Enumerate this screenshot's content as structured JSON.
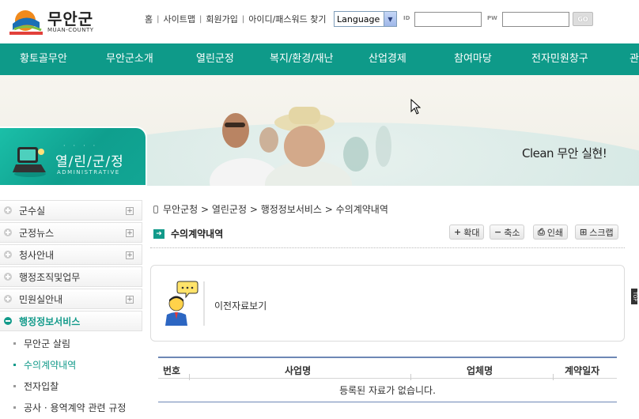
{
  "header": {
    "logo_name": "무안군",
    "logo_sub": "MUAN-COUNTY",
    "util_links": [
      "홈",
      "사이트맵",
      "회원가입",
      "아이디/패스워드 찾기"
    ],
    "language_value": "Language",
    "id_label": "ID",
    "pw_label": "PW",
    "go_label": "GO"
  },
  "nav": {
    "items": [
      "황토골무안",
      "무안군소개",
      "열린군정",
      "복지/환경/재난",
      "산업경제",
      "참여마당",
      "전자민원창구",
      "관"
    ]
  },
  "banner": {
    "slogan": "Clean 무안 실현!"
  },
  "side_title": {
    "ko": "열/린/군/정",
    "en": "ADMINISTRATIVE"
  },
  "sidebar": {
    "items": [
      {
        "label": "군수실",
        "expandable": true
      },
      {
        "label": "군정뉴스",
        "expandable": true
      },
      {
        "label": "청사안내",
        "expandable": true
      },
      {
        "label": "행정조직및업무",
        "expandable": false
      },
      {
        "label": "민원실안내",
        "expandable": true
      },
      {
        "label": "행정정보서비스",
        "expandable": false,
        "active": true
      }
    ],
    "sub_items": [
      "무안군 살림",
      "수의계약내역",
      "전자입찰",
      "공사 · 용역계약 관련 규정"
    ]
  },
  "breadcrumb": "무안군청 > 열린군정 > 행정정보서비스 > 수의계약내역",
  "page_title": "수의계약내역",
  "tools": {
    "zoom_in": "확대",
    "zoom_out": "축소",
    "print": "인쇄",
    "scrap": "스크랩"
  },
  "prev_box": {
    "text": "이전자료보기"
  },
  "table": {
    "columns": [
      "번호",
      "사업명",
      "업체명",
      "계약일자"
    ],
    "empty_message": "등록된 자료가 없습니다."
  },
  "scroll_marker": "TOP"
}
